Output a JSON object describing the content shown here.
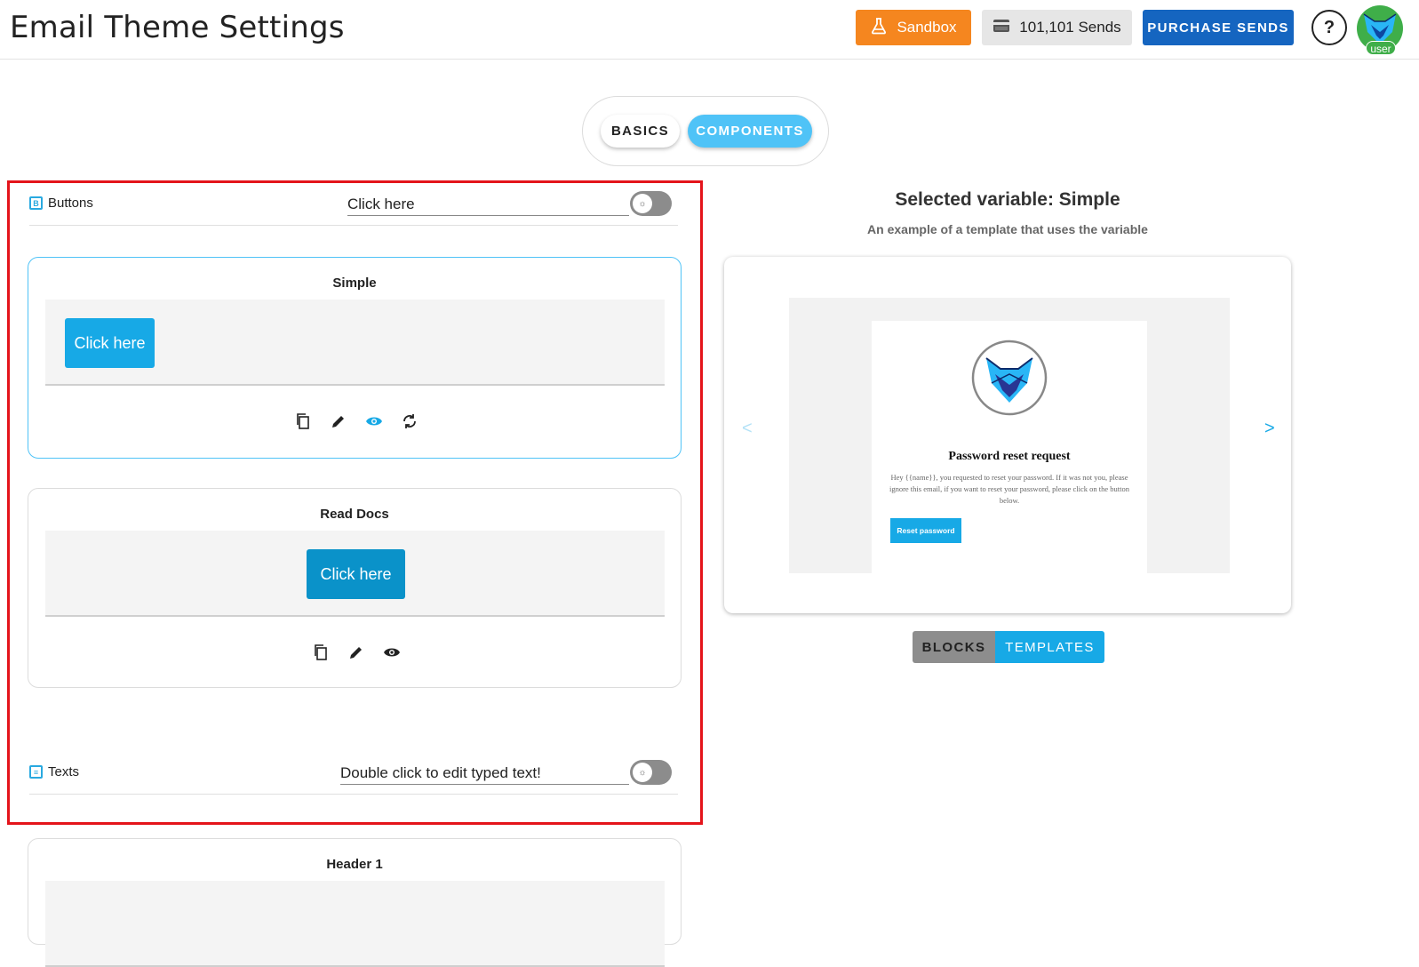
{
  "header": {
    "title": "Email Theme Settings",
    "sandbox_label": "Sandbox",
    "sends_label": "101,101 Sends",
    "purchase_label": "PURCHASE SENDS",
    "help_label": "?",
    "avatar_badge": "user"
  },
  "mode_toggle": {
    "basics": "BASICS",
    "components": "COMPONENTS",
    "selected": "COMPONENTS"
  },
  "sections": {
    "buttons": {
      "label": "Buttons",
      "input_value": "Click here",
      "cards": [
        {
          "title": "Simple",
          "button_text": "Click here",
          "selected": true
        },
        {
          "title": "Read Docs",
          "button_text": "Click here",
          "selected": false
        }
      ]
    },
    "texts": {
      "label": "Texts",
      "input_value": "Double click to edit typed text!",
      "cards": [
        {
          "title": "Header 1"
        }
      ]
    }
  },
  "right_panel": {
    "title": "Selected variable: Simple",
    "subtitle": "An example of a template that uses the variable",
    "email": {
      "heading": "Password reset request",
      "body": "Hey {{name}}, you requested to reset your password. If it was not you, please ignore this email, if you want to reset your password, please click on the button below.",
      "button": "Reset password"
    },
    "prev": "<",
    "next": ">",
    "tabs": {
      "blocks": "BLOCKS",
      "templates": "TEMPLATES",
      "selected": "TEMPLATES"
    }
  },
  "colors": {
    "accent": "#17a9e6",
    "sandbox": "#f5861f",
    "purchase": "#1565c0",
    "highlight_frame": "#e4141b",
    "avatar": "#3fae49"
  },
  "icons": [
    "flask-icon",
    "credit-card-icon",
    "copy-icon",
    "edit-icon",
    "eye-icon",
    "refresh-icon",
    "bold-icon",
    "text-icon",
    "brightness-icon",
    "fox-logo-icon"
  ]
}
